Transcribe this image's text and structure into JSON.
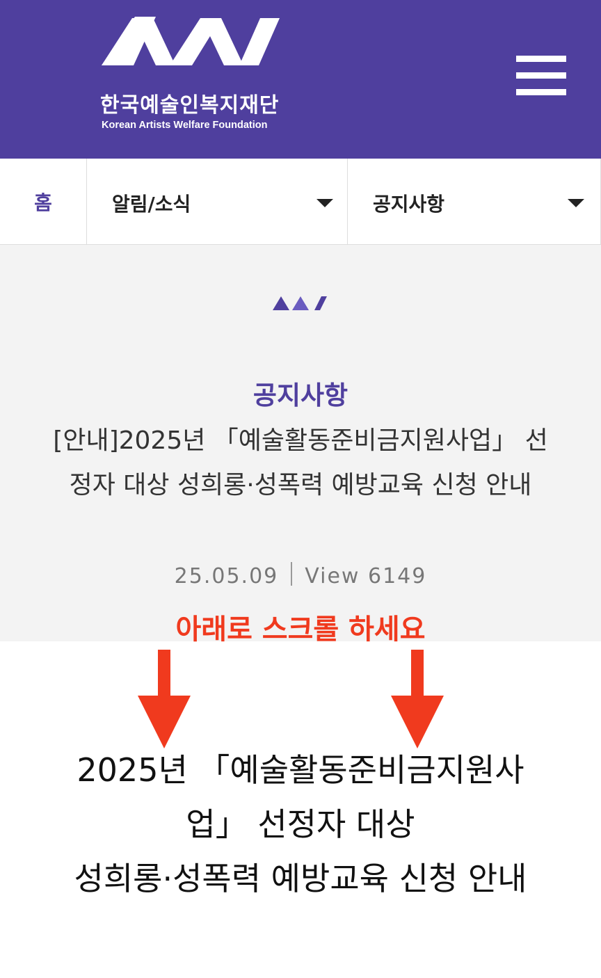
{
  "header": {
    "logo_name_ko": "한국예술인복지재단",
    "logo_name_en": "Korean Artists Welfare Foundation",
    "logo_icon": "kawf-logo-icon",
    "menu_icon": "hamburger-menu-icon",
    "background_color": "#4f3f9e"
  },
  "breadcrumb": {
    "home_label": "홈",
    "category_label": "알림/소식",
    "subcategory_label": "공지사항"
  },
  "post": {
    "category": "공지사항",
    "title": "[안내]2025년 「예술활동준비금지원사업」 선정자 대상 성희롱·성폭력 예방교육 신청 안내",
    "date": "25.05.09",
    "views": "View 6149"
  },
  "overlay": {
    "scroll_hint": "아래로 스크롤 하세요",
    "hint_color": "#f03a1e"
  },
  "content": {
    "line1": "2025년 「예술활동준비금지원사",
    "line2": "업」 선정자 대상",
    "line3": "성희롱·성폭력 예방교육 신청 안내"
  }
}
